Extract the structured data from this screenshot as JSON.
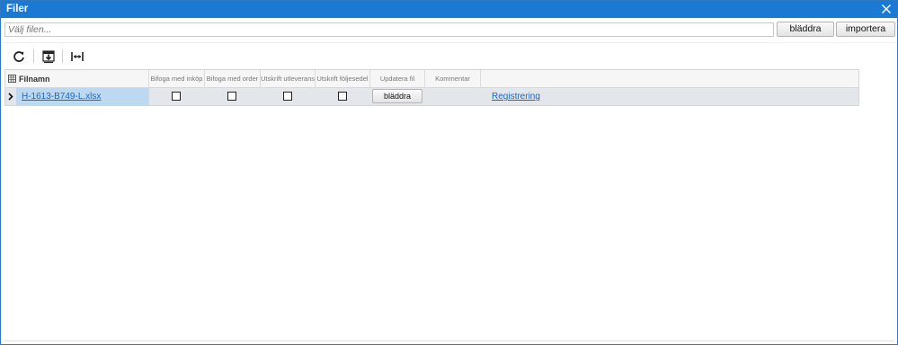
{
  "dialog": {
    "title": "Filer",
    "close_icon": "close-icon"
  },
  "file_picker": {
    "placeholder": "Välj filen...",
    "browse_label": "bläddra",
    "import_label": "importera"
  },
  "toolbar": {
    "icons": [
      "refresh-icon",
      "export-icon",
      "fit-columns-icon"
    ]
  },
  "grid": {
    "columns": [
      "Filnamn",
      "Bifoga med inköp",
      "Bifoga med order",
      "Utskrift utleverans",
      "Utskrift följesedel",
      "Updatera fil",
      "Kommentar"
    ],
    "rows": [
      {
        "filename": "H-1613-B749-L.xlsx",
        "bifoga_inkop": false,
        "bifoga_order": false,
        "utskrift_utleverans": false,
        "utskrift_foljesedel": false,
        "update_button_label": "bläddra",
        "comment": "",
        "link": "Registrering"
      }
    ]
  },
  "colors": {
    "titlebar": "#1a7ad3",
    "selected_cell": "#bcd9f1",
    "row_background": "#e3e6ea",
    "link": "#1b66c4"
  }
}
